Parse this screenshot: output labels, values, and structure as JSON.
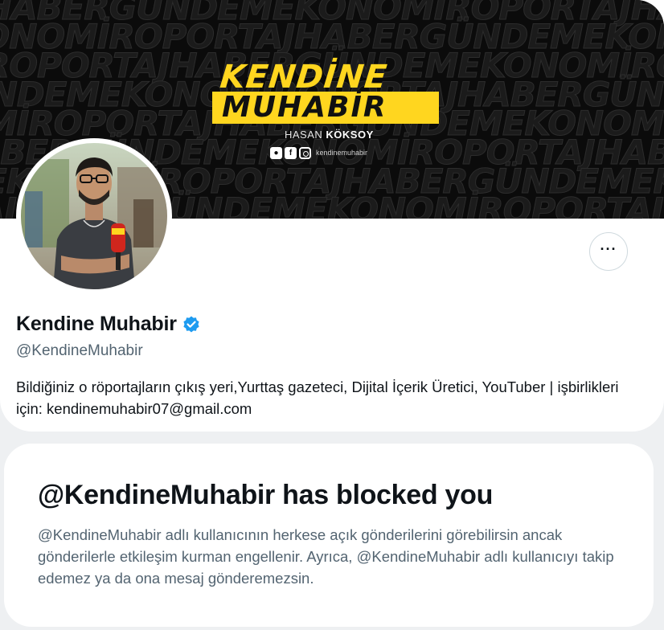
{
  "banner": {
    "bg_words": [
      "HABERGÜNDEMEKONOMİROPORTAJHABERGÜNDEMEKONOMİ",
      "EKONOMİROPORTAJHABERGÜNDEMEKONOMİROPORTAJH",
      "ROPORTAJHABERGÜNDEMEKONOMİROPORTAJHABERGÜN",
      "GÜNDEMEKONOMİROPORTAJHABERGÜNDEMEKONOMİRO",
      "MİROPORTAJHABERGÜNDEMEKONOMİROPORTAJHABER",
      "JHABERGÜNDEMEKONOMİROPORTAJHABERGÜNDEMEK",
      "EKONOMİROPORTAJHABERGÜNDEMEKONOMİROPORTA",
      "RTAJHABERGÜNDEMEKONOMİROPORTAJHABERGÜNDEM"
    ],
    "logo_line1": "KENDİNE",
    "logo_line2": "MUHABİR",
    "person_first": "HASAN",
    "person_last": "KÖKSOY",
    "social_handle": "kendinemuhabir",
    "accent_color": "#ffd61f"
  },
  "profile": {
    "display_name": "Kendine Muhabir",
    "verified_icon": "verified-badge-icon",
    "handle": "@KendineMuhabir",
    "bio": "Bildiğiniz o röportajların çıkış yeri,Yurttaş gazeteci, Dijital İçerik Üretici, YouTuber | işbirlikleri için: kendinemuhabir07@gmail.com",
    "more_icon": "more-horizontal-icon"
  },
  "blocked": {
    "title": "@KendineMuhabir has blocked you",
    "description": "@KendineMuhabir adlı kullanıcının herkese açık gönderilerini görebilirsin ancak gönderilerle etkileşim kurman engellenir. Ayrıca, @KendineMuhabir adlı kullanıcıyı takip edemez ya da ona mesaj gönderemezsin."
  }
}
